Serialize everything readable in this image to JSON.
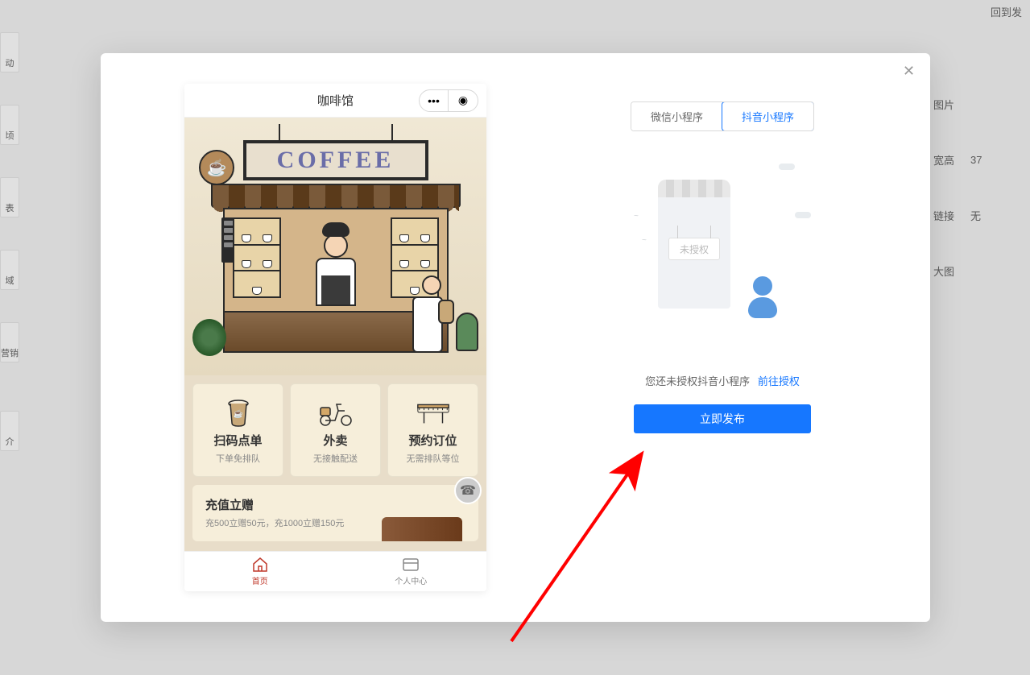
{
  "bg": {
    "top_right": "回到发",
    "sidebar_items": [
      "动",
      "顷",
      "表",
      "域",
      "营销",
      "介"
    ],
    "form_labels": [
      "图片",
      "宽高",
      "链接",
      "大图"
    ],
    "form_values": [
      "",
      "37",
      "无",
      ""
    ]
  },
  "modal": {
    "close_label": "✕"
  },
  "preview": {
    "title": "咖啡馆",
    "coffee_sign": "COFFEE",
    "coffee_icon": "☕",
    "actions": [
      {
        "title": "扫码点单",
        "sub": "下单免排队"
      },
      {
        "title": "外卖",
        "sub": "无接触配送"
      },
      {
        "title": "预约订位",
        "sub": "无需排队等位"
      }
    ],
    "promo": {
      "title": "充值立赠",
      "sub": "充500立赠50元，充1000立赠150元",
      "fab": "☎"
    },
    "nav": [
      {
        "label": "首页",
        "icon": "home"
      },
      {
        "label": "个人中心",
        "icon": "card"
      }
    ]
  },
  "settings": {
    "tabs": [
      {
        "label": "微信小程序",
        "active": false
      },
      {
        "label": "抖音小程序",
        "active": true
      }
    ],
    "unauth_sign": "未授权",
    "message": "您还未授权抖音小程序",
    "link": "前往授权",
    "publish_btn": "立即发布"
  }
}
